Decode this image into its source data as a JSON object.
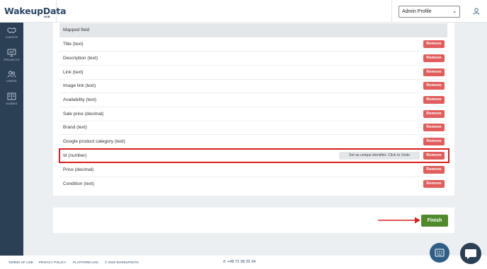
{
  "brand": {
    "name": "WakeupData",
    "sub": "HUB"
  },
  "header": {
    "profile_selected": "Admin Profile"
  },
  "sidebar": {
    "items": [
      {
        "label": "CLIENTS",
        "icon": "handshake-icon"
      },
      {
        "label": "PROJECTS",
        "icon": "presentation-icon"
      },
      {
        "label": "USERS",
        "icon": "users-icon"
      },
      {
        "label": "GUIDES",
        "icon": "book-icon"
      }
    ]
  },
  "table": {
    "header": "Mapped field",
    "remove_label": "Remove",
    "rows": [
      {
        "label": "Title (text)"
      },
      {
        "label": "Description (text)"
      },
      {
        "label": "Link (text)"
      },
      {
        "label": "Image link (text)"
      },
      {
        "label": "Availability (text)"
      },
      {
        "label": "Sale price (decimal)"
      },
      {
        "label": "Brand (text)"
      },
      {
        "label": "Google product category (text)"
      },
      {
        "label": "Id (number)",
        "unique_label": "Set as unique identifier. Click to Undo"
      },
      {
        "label": "Price (decimal)"
      },
      {
        "label": "Condition (text)"
      }
    ]
  },
  "actions": {
    "finish_label": "Finish"
  },
  "footer": {
    "links": [
      "TERMS OF USE",
      "PRIVACY POLICY",
      "PLATFORM LOG",
      "© 2020 WAKEUPDATA"
    ],
    "phone": "+45 71 99 29 34"
  },
  "colors": {
    "sidebar": "#2b3f55",
    "remove": "#e25c5c",
    "finish": "#4f8a2d",
    "highlight": "#d81f1f"
  }
}
